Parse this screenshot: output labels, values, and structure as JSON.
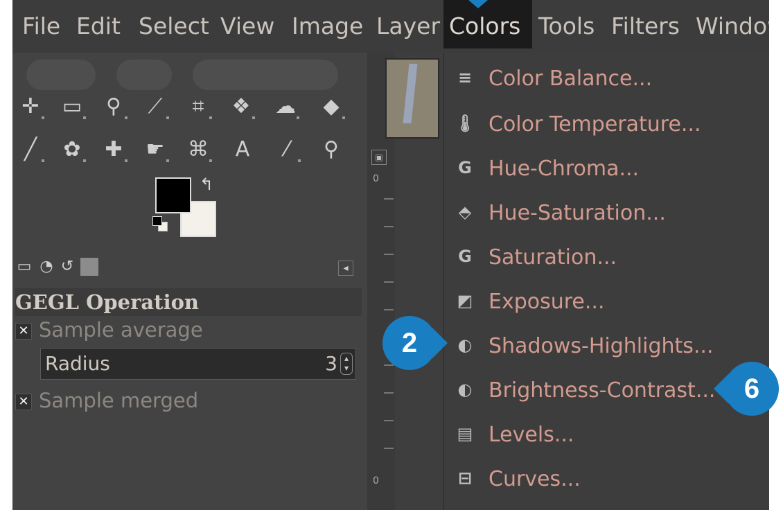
{
  "menubar": {
    "items": [
      "File",
      "Edit",
      "Select",
      "View",
      "Image",
      "Layer",
      "Colors",
      "Tools",
      "Filters",
      "Window"
    ]
  },
  "toolbox": {
    "tools_row1": [
      "move-tool",
      "rect-select-tool",
      "free-select-tool",
      "fuzzy-select-tool",
      "crop-tool",
      "transform-tool",
      "warp-tool",
      "bucket-fill-tool"
    ],
    "tools_row2": [
      "paintbrush-tool",
      "clone-tool",
      "heal-tool",
      "smudge-tool",
      "paths-tool",
      "text-tool",
      "color-picker-tool",
      "zoom-tool"
    ],
    "text_tool_glyph": "A"
  },
  "tool_options": {
    "section_title": "GEGL Operation",
    "sample_average_label": "Sample average",
    "radius_label": "Radius",
    "radius_value": "3",
    "sample_merged_label": "Sample merged"
  },
  "colors_menu": {
    "items": [
      {
        "label": "Color Balance...",
        "icon": "color-balance-icon"
      },
      {
        "label": "Color Temperature...",
        "icon": "color-temperature-icon"
      },
      {
        "label": "Hue-Chroma...",
        "icon": "hue-chroma-icon"
      },
      {
        "label": "Hue-Saturation...",
        "icon": "hue-saturation-icon"
      },
      {
        "label": "Saturation...",
        "icon": "saturation-icon"
      },
      {
        "label": "Exposure...",
        "icon": "exposure-icon"
      },
      {
        "label": "Shadows-Highlights...",
        "icon": "shadows-highlights-icon"
      },
      {
        "label": "Brightness-Contrast...",
        "icon": "brightness-contrast-icon"
      },
      {
        "label": "Levels...",
        "icon": "levels-icon"
      },
      {
        "label": "Curves...",
        "icon": "curves-icon"
      }
    ]
  },
  "ruler": {
    "label_top": "0",
    "label_bottom": "0"
  },
  "callouts": {
    "step_a": "2",
    "step_b": "6"
  },
  "colors": {
    "callout": "#1a7ec2",
    "menu_text": "#d39b8f",
    "menu_bg": "#3d3d3d",
    "active_menu_bg": "#1b1b1b"
  }
}
